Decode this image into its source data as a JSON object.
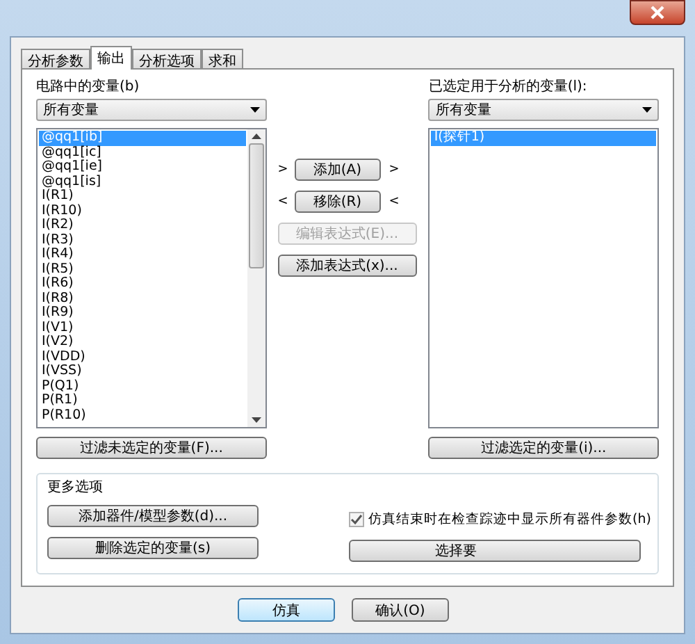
{
  "tabs": [
    {
      "label": "分析参数",
      "selected": false
    },
    {
      "label": "输出",
      "selected": true
    },
    {
      "label": "分析选项",
      "selected": false
    },
    {
      "label": "求和",
      "selected": false
    }
  ],
  "left": {
    "label": "电路中的变量(b)",
    "filter": "所有变量",
    "items": [
      {
        "text": "@qq1[ib]",
        "selected": true
      },
      {
        "text": "@qq1[ic]",
        "selected": false
      },
      {
        "text": "@qq1[ie]",
        "selected": false
      },
      {
        "text": "@qq1[is]",
        "selected": false
      },
      {
        "text": "I(R1)",
        "selected": false
      },
      {
        "text": "I(R10)",
        "selected": false
      },
      {
        "text": "I(R2)",
        "selected": false
      },
      {
        "text": "I(R3)",
        "selected": false
      },
      {
        "text": "I(R4)",
        "selected": false
      },
      {
        "text": "I(R5)",
        "selected": false
      },
      {
        "text": "I(R6)",
        "selected": false
      },
      {
        "text": "I(R8)",
        "selected": false
      },
      {
        "text": "I(R9)",
        "selected": false
      },
      {
        "text": "I(V1)",
        "selected": false
      },
      {
        "text": "I(V2)",
        "selected": false
      },
      {
        "text": "I(VDD)",
        "selected": false
      },
      {
        "text": "I(VSS)",
        "selected": false
      },
      {
        "text": "P(Q1)",
        "selected": false
      },
      {
        "text": "P(R1)",
        "selected": false
      },
      {
        "text": "P(R10)",
        "selected": false
      }
    ],
    "filter_button": "过滤未选定的变量(F)..."
  },
  "middle": [
    {
      "label": "添加(A)",
      "disabled": false,
      "left_mark": ">",
      "right_mark": ">"
    },
    {
      "label": "移除(R)",
      "disabled": false,
      "left_mark": "<",
      "right_mark": "<"
    },
    {
      "label": "编辑表达式(E)...",
      "disabled": true
    },
    {
      "label": "添加表达式(x)...",
      "disabled": false
    }
  ],
  "right": {
    "label": "已选定用于分析的变量(l):",
    "filter": "所有变量",
    "items": [
      {
        "text": "I(探针1)",
        "selected": true
      }
    ],
    "filter_button": "过滤选定的变量(i)..."
  },
  "more": {
    "title": "更多选项",
    "buttons": [
      "添加器件/模型参数(d)...",
      "删除选定的变量(s)"
    ],
    "checkbox": {
      "label": "仿真结束时在检查踪迹中显示所有器件参数(h)",
      "checked": true
    },
    "select_button": "选择要"
  },
  "footer": [
    "仿真",
    "确认(O)"
  ]
}
